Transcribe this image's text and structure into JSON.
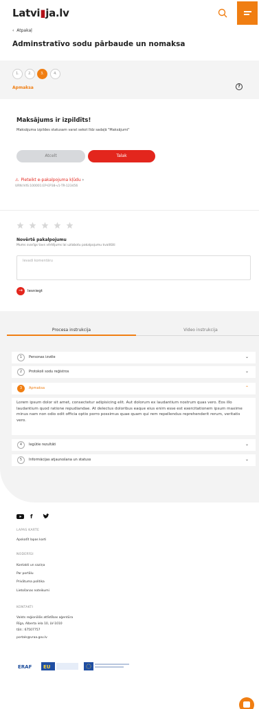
{
  "header": {
    "logo_text_a": "Latvi",
    "logo_text_b": "ja.lv",
    "search_icon": "search-icon",
    "menu_icon": "menu-icon",
    "accent": "#f07e12"
  },
  "nav": {
    "back_label": "Atpakaļ",
    "page_title": "Adminstratīvo sodu pārbaude un nomaksa"
  },
  "steps": {
    "items": [
      "1.",
      "2.",
      "3.",
      "4."
    ],
    "active_index": 2,
    "current_label": "Apmaksa"
  },
  "result": {
    "title": "Maksājums ir izpildīts!",
    "text": "Maksājuma izpildes statusam varat sekot līdz sadaļā \"Maksājumi\"",
    "cancel_label": "Atcelt",
    "next_label": "Talak",
    "report_label": "Pieteikt e-pakalpojuma kļūdu",
    "urn": "URN:IVIS:100001:EP-EP38-v1-TR-123456"
  },
  "rating": {
    "stars": 5,
    "title": "Novērtē pakalpojumu",
    "subtitle": "Mums svarīgs tavs vērtējums lai uzlabotu pakalpojumu kvalitāti",
    "comment_placeholder": "Ievadi komentāru",
    "submit_label": "Iesniegt"
  },
  "instructions": {
    "tabs": [
      "Procesa instrukcija",
      "Video instrukcija"
    ],
    "active_tab": 0,
    "items": [
      {
        "num": "1",
        "label": "Personas izvēle"
      },
      {
        "num": "2",
        "label": "Protokoli sodu reģistros"
      },
      {
        "num": "3",
        "label": "Apmaksa"
      },
      {
        "num": "4",
        "label": "Iegūtie rezultāti"
      },
      {
        "num": "5",
        "label": "Informācijas atjaunošana un statuss"
      }
    ],
    "expanded_index": 2,
    "expanded_text": "Lorem ipsum dolor sit amet, consectetur adipisicing elit. Aut dolorum ex laudantium nostrum quas vero. Eos illo laudantium quod ratione repudiandae. At delectus doloribus eaque eius enim esse est exercitationem ipsum maxime minus nam non odio odit officia optio porro possimus quae quam qui rem repellendus reprehenderit rerum, veritatis vero."
  },
  "footer": {
    "social": [
      "youtube-icon",
      "facebook-icon",
      "twitter-icon"
    ],
    "sitemap_heading": "LAPAS KARTE",
    "sitemap_link": "Apskatīt lapas karti",
    "useful_heading": "NODERĪGI",
    "useful_links": [
      "Kontakti un saziņa",
      "Par portālu",
      "Privātuma politika",
      "Lietošanas noteikumi"
    ],
    "contacts_heading": "KONTAKTI",
    "contacts": [
      "Valsts reģionālās attīstības aģentūra",
      "Rīga, Alberta iela 10, LV-1010",
      "tālr.: 67507757",
      "portals@vraa.gov.lv"
    ],
    "partner_logos": [
      "ERAF",
      "EU",
      "Eiropas Savienība"
    ]
  },
  "chat": {
    "icon": "chat-icon"
  }
}
